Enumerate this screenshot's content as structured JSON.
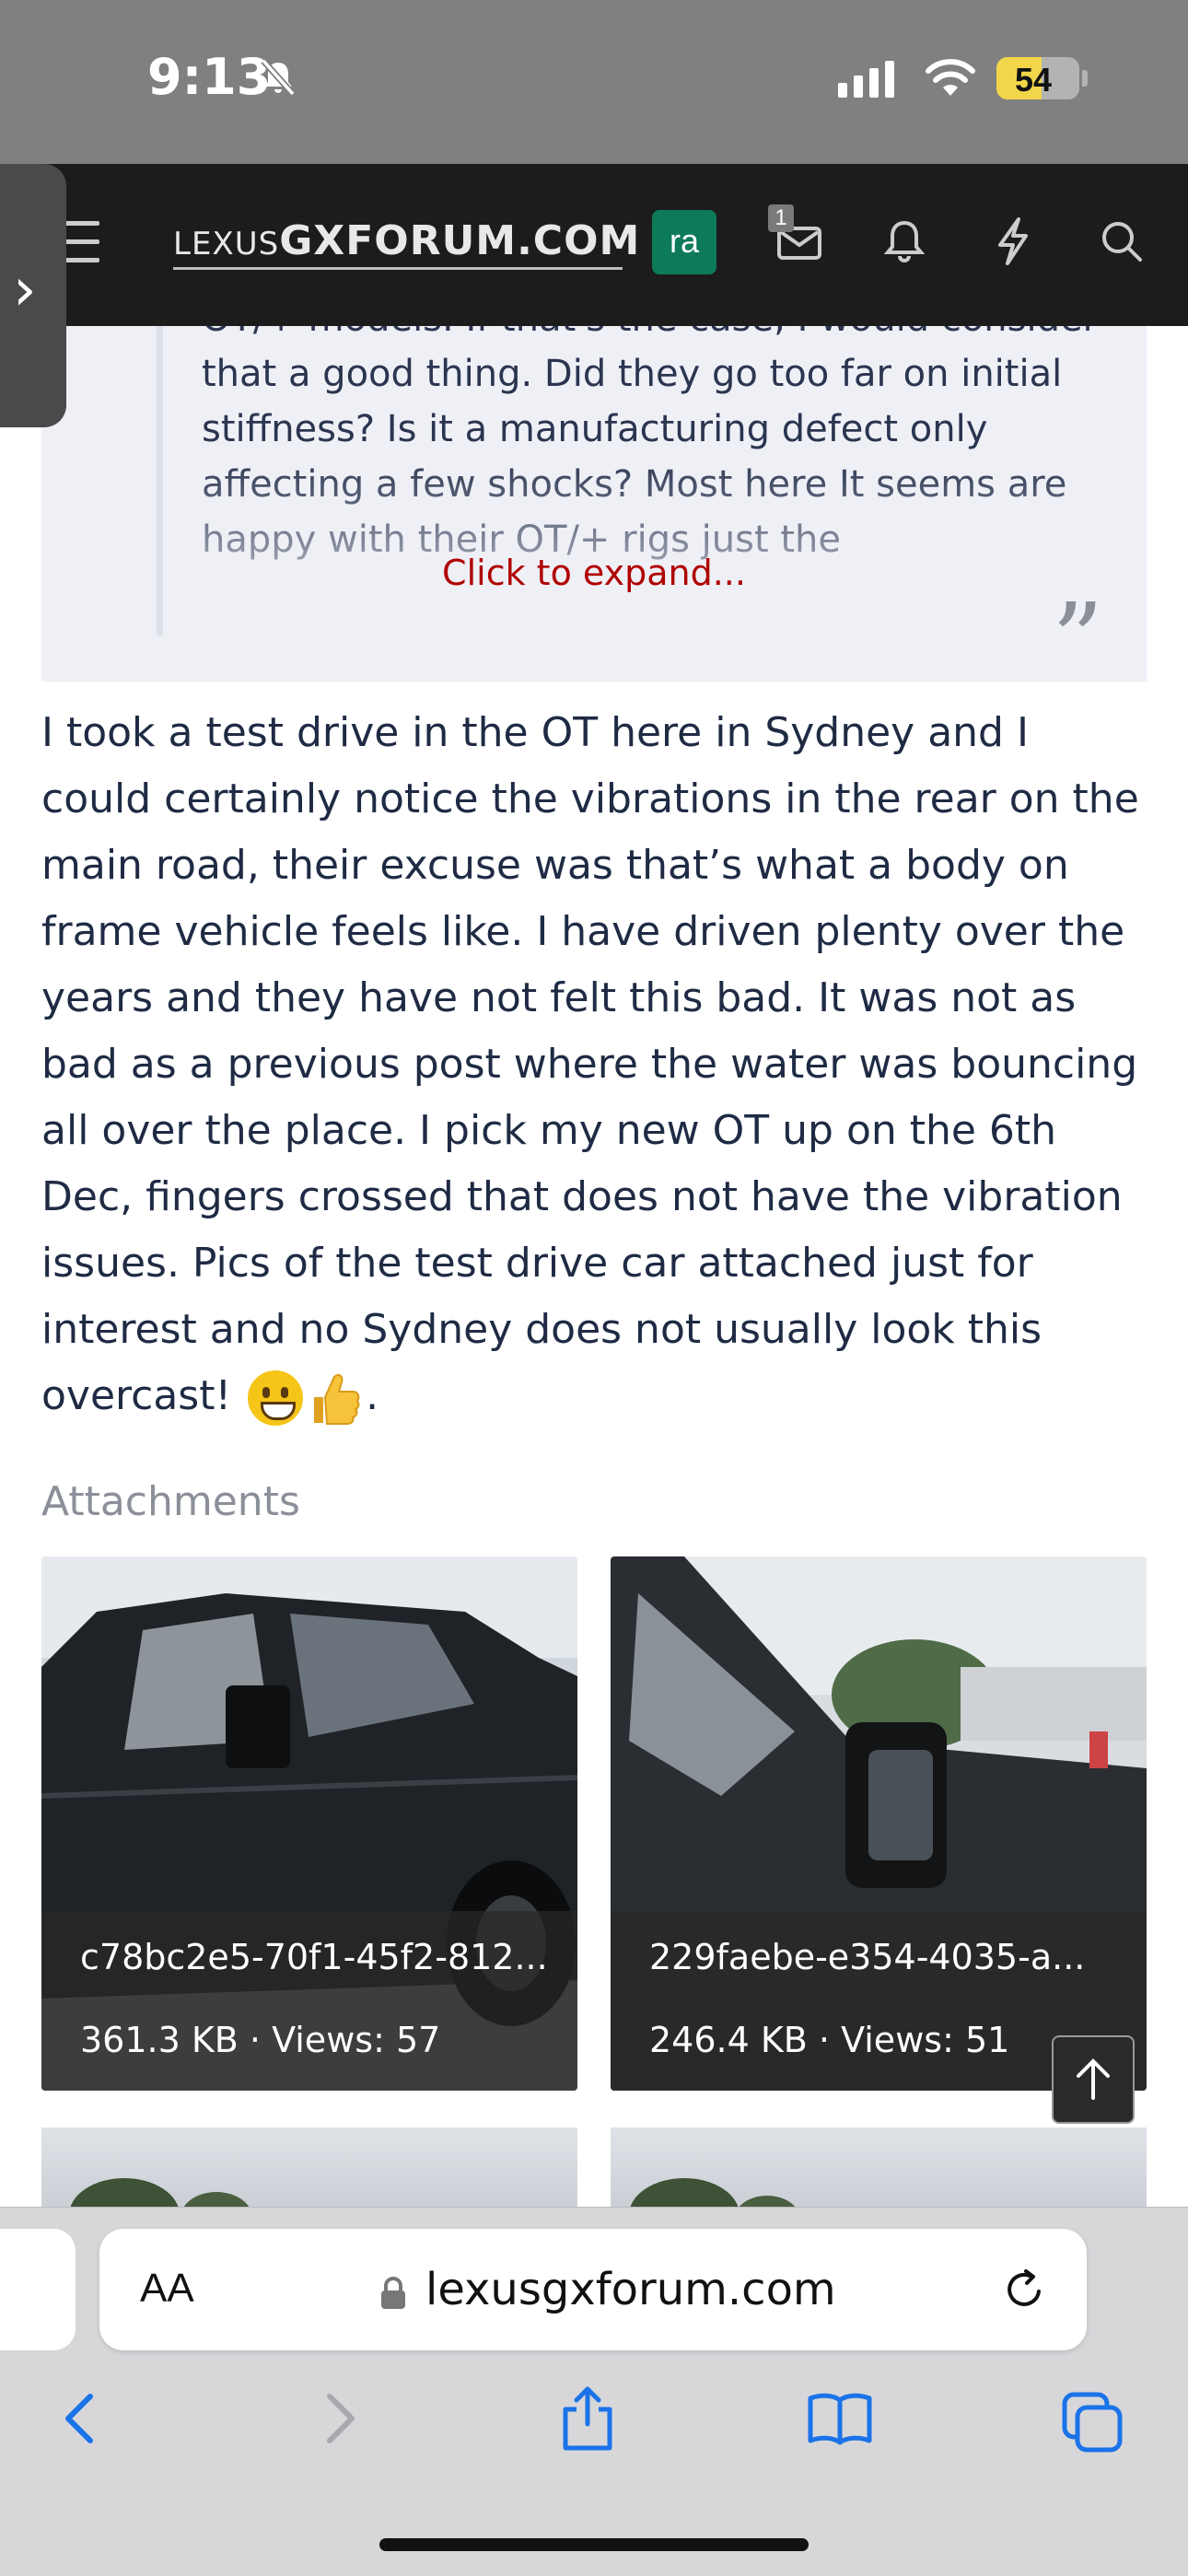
{
  "status_bar": {
    "time": "9:13",
    "battery": "54",
    "battery_level": 0.54
  },
  "navbar": {
    "logo_small": "LEXUS",
    "logo_big": "GXFORUM.COM",
    "avatar_initials": "ra",
    "messages_badge": "1"
  },
  "quote": {
    "text": "OT/+ models. If that's the case, I would consider that a good thing. Did they go too far on initial stiffness? Is it a manufacturing defect only affecting a few shocks? Most here It seems are happy with their OT/+ rigs just the",
    "expand_label": "Click to expand..."
  },
  "post": {
    "body": "I took a test drive in the OT here in Sydney and I could certainly notice the vibrations in the rear on the main road, their excuse was that’s what a body on frame vehicle feels like. I have driven plenty over the years and they have not felt this bad. It was not as bad as a previous post where the water was bouncing all over the place. I pick my new OT up on the 6th Dec, fingers crossed that does not have the vibration issues. Pics of the test drive car attached just for interest and no Sydney does not usually look this overcast!",
    "ending": "."
  },
  "attachments": {
    "label": "Attachments",
    "items": [
      {
        "name": "c78bc2e5-70f1-45f2-812...",
        "meta": "361.3 KB · Views: 57"
      },
      {
        "name": "229faebe-e354-4035-a...",
        "meta": "246.4 KB · Views: 51"
      }
    ]
  },
  "browser": {
    "aa_label": "AA",
    "url": "lexusgxforum.com"
  },
  "colors": {
    "status_bar": "#808080",
    "navbar": "#1c1c1c",
    "quote_bg": "#eef0f6",
    "expand_link": "#b00000",
    "body_text": "#1f2b44",
    "safari_blue": "#1a73e8"
  },
  "icons": [
    "bell-slash-icon",
    "signal-icon",
    "wifi-icon",
    "battery-icon",
    "chevron-right-icon",
    "menu-icon",
    "envelope-icon",
    "bell-icon",
    "bolt-icon",
    "search-icon",
    "quote-icon",
    "arrow-up-icon",
    "lock-icon",
    "reload-icon",
    "back-icon",
    "forward-icon",
    "share-icon",
    "bookmarks-icon",
    "tabs-icon"
  ]
}
